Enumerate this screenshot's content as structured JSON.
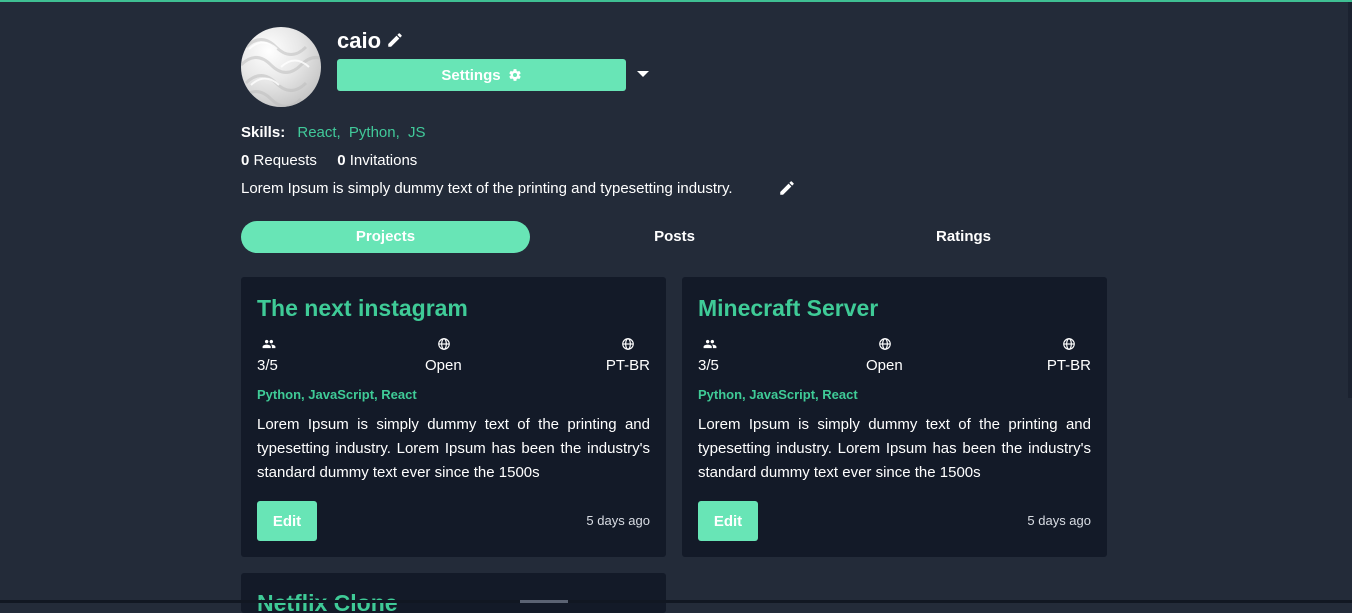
{
  "profile": {
    "username": "caio",
    "settings_label": "Settings",
    "skills_label": "Skills:",
    "skills": [
      "React,",
      "Python,",
      "JS"
    ],
    "requests_count": "0",
    "requests_label": "Requests",
    "invitations_count": "0",
    "invitations_label": "Invitations",
    "bio": "Lorem Ipsum is simply dummy text of the printing and typesetting industry."
  },
  "tabs": [
    {
      "label": "Projects",
      "active": true
    },
    {
      "label": "Posts",
      "active": false
    },
    {
      "label": "Ratings",
      "active": false
    }
  ],
  "projects": [
    {
      "title": "The next instagram",
      "members": "3/5",
      "status": "Open",
      "language": "PT-BR",
      "tech": "Python, JavaScript, React",
      "description": "Lorem Ipsum is simply dummy text of the printing and typesetting industry. Lorem Ipsum has been the industry's standard dummy text ever since the 1500s",
      "edit_label": "Edit",
      "time": "5 days ago"
    },
    {
      "title": "Minecraft Server",
      "members": "3/5",
      "status": "Open",
      "language": "PT-BR",
      "tech": "Python, JavaScript, React",
      "description": "Lorem Ipsum is simply dummy text of the printing and typesetting industry. Lorem Ipsum has been the industry's standard dummy text ever since the 1500s",
      "edit_label": "Edit",
      "time": "5 days ago"
    },
    {
      "title": "Netflix Clone"
    }
  ],
  "colors": {
    "background": "#232b39",
    "card": "#131a28",
    "accent": "#68e5b6",
    "accent_text": "#3fcb97"
  },
  "icons": {
    "edit": "pencil-icon",
    "settings": "gear-icon",
    "members": "people-icon",
    "status": "globe-icon",
    "language": "globe-icon",
    "dropdown": "caret-down-icon"
  }
}
